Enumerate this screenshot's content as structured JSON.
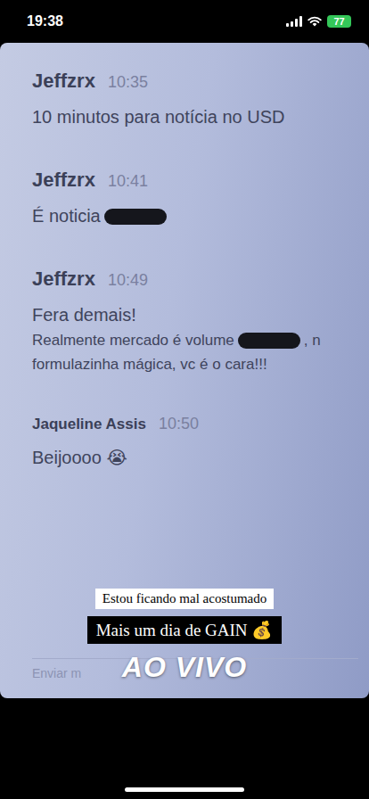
{
  "status_bar": {
    "time": "19:38",
    "battery": "77",
    "battery_color": "#34c759"
  },
  "chat": {
    "messages": [
      {
        "author": "Jeffzrx",
        "time": "10:35",
        "paragraphs": [
          {
            "size": "large",
            "segments": [
              {
                "kind": "text",
                "text": "10 minutos para notícia no USD"
              }
            ]
          }
        ]
      },
      {
        "author": "Jeffzrx",
        "time": "10:41",
        "paragraphs": [
          {
            "size": "large",
            "segments": [
              {
                "kind": "text",
                "text": "É noticia"
              },
              {
                "kind": "redaction"
              }
            ]
          }
        ]
      },
      {
        "author": "Jeffzrx",
        "time": "10:49",
        "paragraphs": [
          {
            "size": "large",
            "segments": [
              {
                "kind": "text",
                "text": "Fera demais!"
              }
            ]
          },
          {
            "size": "small",
            "segments": [
              {
                "kind": "text",
                "text": "Realmente mercado é volume"
              },
              {
                "kind": "redaction"
              },
              {
                "kind": "text",
                "text": ", n"
              }
            ]
          },
          {
            "size": "small",
            "segments": [
              {
                "kind": "text",
                "text": "formulazinha mágica, vc é o cara!!!"
              }
            ]
          }
        ]
      },
      {
        "author": "Jaqueline Assis",
        "time": "10:50",
        "paragraphs": [
          {
            "size": "large",
            "segments": [
              {
                "kind": "text",
                "text": "Beijoooo 😭"
              }
            ]
          }
        ]
      }
    ],
    "input_placeholder": "Enviar m"
  },
  "stickers": [
    {
      "kind": "white",
      "text": "Estou ficando mal acostumado"
    },
    {
      "kind": "black",
      "text": "Mais um dia de GAIN 💰"
    },
    {
      "kind": "live",
      "text": "AO VIVO"
    }
  ]
}
